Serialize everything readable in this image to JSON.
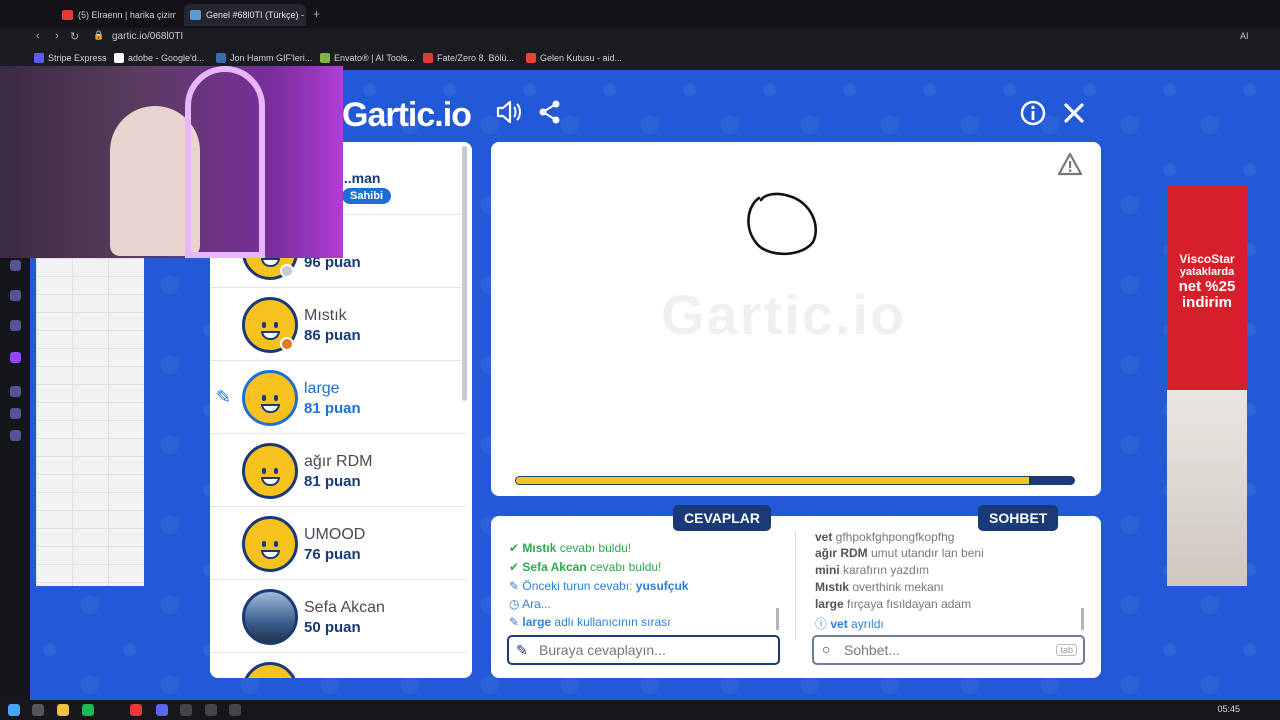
{
  "browser": {
    "tabs": [
      {
        "title": "(5) Elraenn | harika çizimle",
        "active": false
      },
      {
        "title": "Genel #68l0TI (Türkçe) - G",
        "active": true
      }
    ],
    "new_tab": "+",
    "url": "gartic.io/068l0TI",
    "bookmarks": [
      "Stripe Express",
      "adobe - Google'd...",
      "Jon Hamm GIF'leri...",
      "Envato® | AI Tools...",
      "Fate/Zero 8. Bölü...",
      "Gelen Kutusu - aid..."
    ],
    "ai_label": "AI"
  },
  "game": {
    "logo": "Gartic.io",
    "canvas_watermark": "Gartic.io",
    "timer_progress": 0.92,
    "owner_badge": "Sahibi",
    "players": [
      {
        "name": "...man",
        "points": "",
        "owner": true,
        "badge": ""
      },
      {
        "name": "",
        "points": "96 puan",
        "badge": "#c7c7cc"
      },
      {
        "name": "Mıstık",
        "points": "86 puan",
        "badge": "#e07b1a"
      },
      {
        "name": "large",
        "points": "81 puan",
        "drawing": true
      },
      {
        "name": "ağır RDM",
        "points": "81 puan"
      },
      {
        "name": "UMOOD",
        "points": "76 puan"
      },
      {
        "name": "Sefa Akcan",
        "points": "50 puan",
        "photo": true
      }
    ],
    "answers_tab": "CEVAPLAR",
    "chat_tab": "SOHBET",
    "answers": [
      {
        "type": "ok",
        "name": "Mıstık",
        "text": " cevabı buldu!"
      },
      {
        "type": "ok",
        "name": "Sefa Akcan",
        "text": " cevabı buldu!"
      },
      {
        "type": "info",
        "prefix": "Önceki turun cevabı: ",
        "name": "yusufçuk"
      },
      {
        "type": "info",
        "text": "Ara..."
      },
      {
        "type": "info",
        "name": "large",
        "text": " adlı kullanıcının sırası"
      }
    ],
    "chat": [
      {
        "name": "vet",
        "text": " gfhpokfghpongfkopfhg"
      },
      {
        "name": "ağır RDM",
        "text": " umut utandır lan beni"
      },
      {
        "name": "mini",
        "text": " karafırın yazdım"
      },
      {
        "name": "Mıstık",
        "text": " overthink mekanı"
      },
      {
        "name": "large",
        "text": " fırçaya fısıldayan adam"
      },
      {
        "name": "vet",
        "text": " ayrıldı",
        "info": true
      }
    ],
    "answer_placeholder": "Buraya cevaplayın...",
    "chat_placeholder": "Sohbet...",
    "tab_key": "tab"
  },
  "ad": {
    "brand": "ViscoStar",
    "line1": "yataklarda",
    "line2": "net %25",
    "line3": "indirim"
  },
  "taskbar": {
    "time": "05:45"
  },
  "colors": {
    "game_bg": "#2259d6",
    "navy": "#193a77",
    "yellow": "#f5c518",
    "green": "#2fa84f",
    "blue": "#1d6fd6"
  }
}
